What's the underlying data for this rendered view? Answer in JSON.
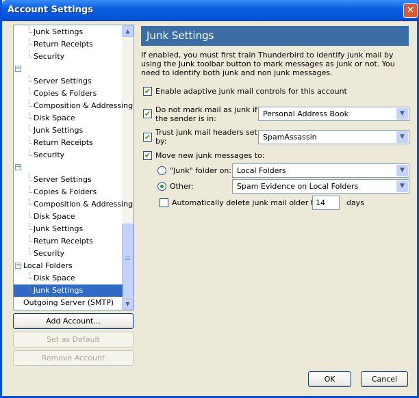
{
  "window": {
    "title": "Account Settings",
    "close_icon": "close-icon"
  },
  "tree": {
    "items": [
      {
        "label": "Junk Settings",
        "level": 2
      },
      {
        "label": "Return Receipts",
        "level": 2
      },
      {
        "label": "Security",
        "level": 2
      },
      {
        "label": "",
        "level": 1,
        "expander": "minus"
      },
      {
        "label": "Server Settings",
        "level": 2
      },
      {
        "label": "Copies & Folders",
        "level": 2
      },
      {
        "label": "Composition & Addressing",
        "level": 2
      },
      {
        "label": "Disk Space",
        "level": 2
      },
      {
        "label": "Junk Settings",
        "level": 2
      },
      {
        "label": "Return Receipts",
        "level": 2
      },
      {
        "label": "Security",
        "level": 2
      },
      {
        "label": "",
        "level": 1,
        "expander": "minus"
      },
      {
        "label": "Server Settings",
        "level": 2
      },
      {
        "label": "Copies & Folders",
        "level": 2
      },
      {
        "label": "Composition & Addressing",
        "level": 2
      },
      {
        "label": "Disk Space",
        "level": 2
      },
      {
        "label": "Junk Settings",
        "level": 2
      },
      {
        "label": "Return Receipts",
        "level": 2
      },
      {
        "label": "Security",
        "level": 2
      },
      {
        "label": "Local Folders",
        "level": 1,
        "expander": "minus"
      },
      {
        "label": "Disk Space",
        "level": 2
      },
      {
        "label": "Junk Settings",
        "level": 2,
        "selected": true
      },
      {
        "label": "Outgoing Server (SMTP)",
        "level": 1
      }
    ]
  },
  "buttons": {
    "add_account": "Add Account...",
    "set_default": "Set as Default",
    "remove_account": "Remove Account",
    "ok": "OK",
    "cancel": "Cancel"
  },
  "panel": {
    "title": "Junk Settings",
    "description": "If enabled, you must first train Thunderbird to identify junk mail by using the Junk toolbar button to mark messages as junk or not. You need to identify both junk and non junk messages.",
    "enable_adaptive": {
      "label": "Enable adaptive junk mail controls for this account",
      "checked": true
    },
    "whitelist": {
      "label_line1": "Do not mark mail as junk if",
      "label_line2": "the sender is in:",
      "checked": true,
      "value": "Personal Address Book"
    },
    "trust_headers": {
      "label_line1": "Trust junk mail headers set",
      "label_line2": "by:",
      "checked": true,
      "value": "SpamAssassin"
    },
    "move_junk": {
      "label": "Move new junk messages to:",
      "checked": true
    },
    "junk_folder": {
      "label": "\"Junk\" folder on:",
      "selected": false,
      "value": "Local Folders"
    },
    "other": {
      "label": "Other:",
      "selected": true,
      "value": "Spam Evidence on Local Folders"
    },
    "auto_delete": {
      "label": "Automatically delete junk mail older than",
      "checked": false,
      "days": "14",
      "unit": "days"
    }
  },
  "colors": {
    "header": "#3a6ea5",
    "selection": "#316ac5",
    "titlebar": "#0654d8"
  }
}
